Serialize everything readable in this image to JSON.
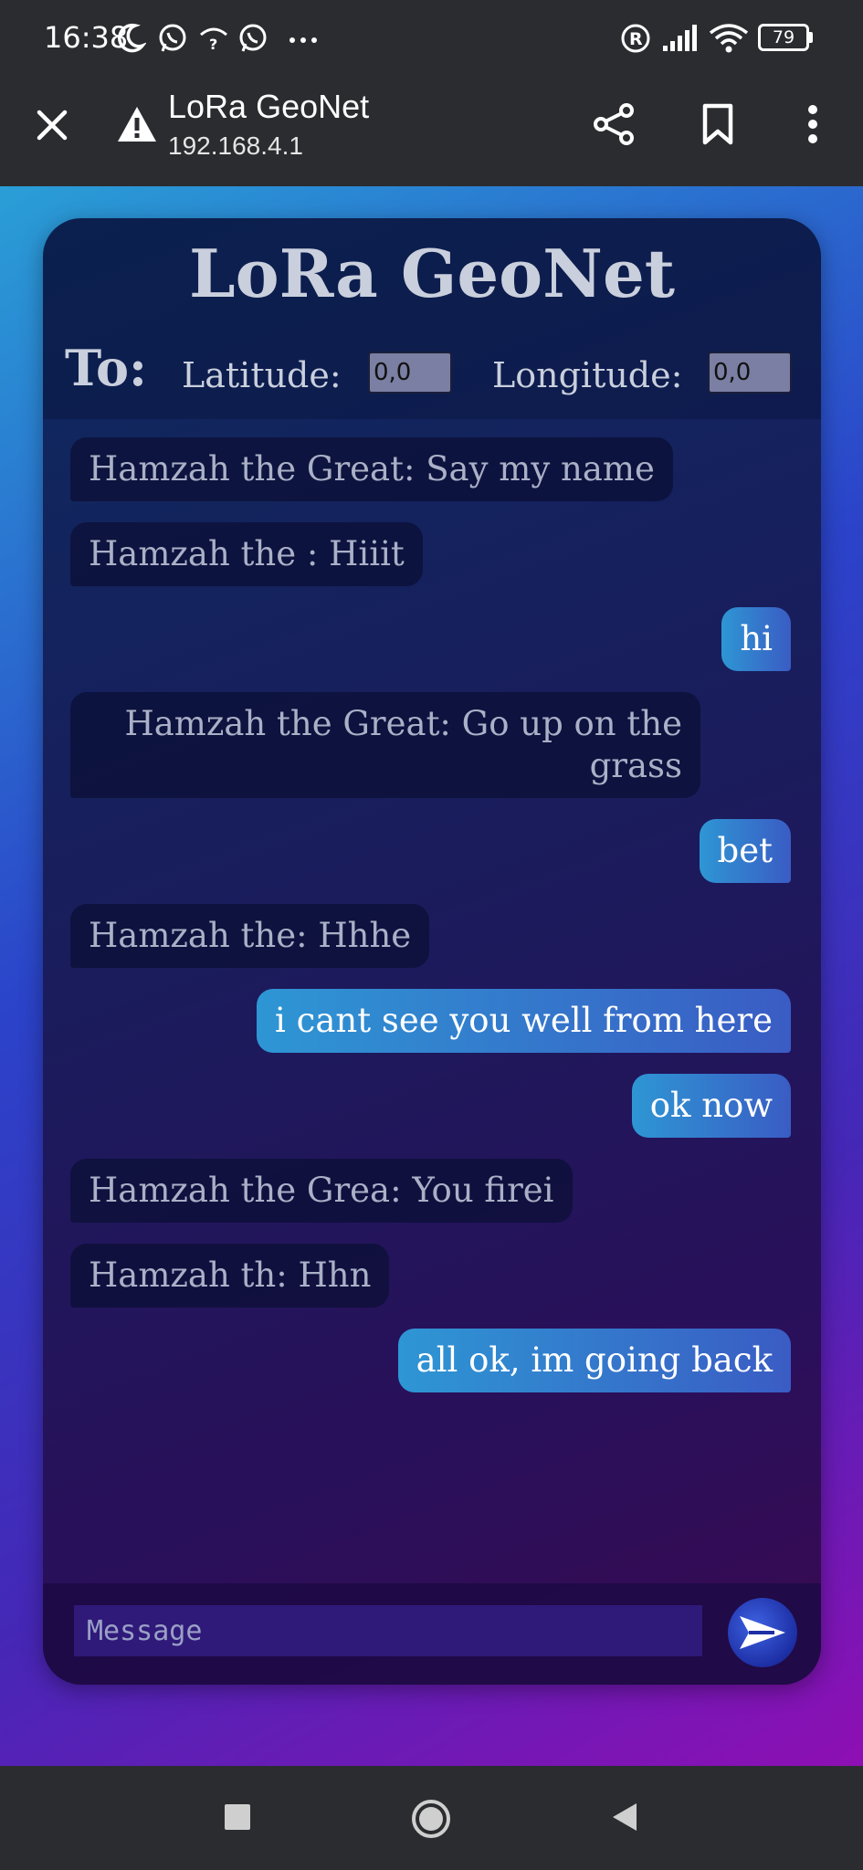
{
  "status_bar": {
    "time": "16:38",
    "icons": [
      "moon-icon",
      "whatsapp-icon",
      "wifi-question-icon",
      "whatsapp-icon",
      "more-dots-icon",
      "registered-icon",
      "signal-icon",
      "wifi-icon",
      "battery-icon"
    ],
    "battery": "79"
  },
  "browser": {
    "close_icon": "close-icon",
    "warning_icon": "warning-icon",
    "title": "LoRa GeoNet",
    "url": "192.168.4.1",
    "actions": [
      "share-icon",
      "bookmark-icon",
      "more-vertical-icon"
    ]
  },
  "app": {
    "title": "LoRa GeoNet",
    "to_label": "To:",
    "latitude_label": "Latitude:",
    "latitude_value": "0,0",
    "longitude_label": "Longitude:",
    "longitude_value": "0,0"
  },
  "messages": [
    {
      "dir": "in",
      "text": "Hamzah the Great: Say my name"
    },
    {
      "dir": "in",
      "text": "Hamzah the : Hiiit"
    },
    {
      "dir": "out",
      "text": "hi"
    },
    {
      "dir": "in",
      "text": "Hamzah the Great: Go up on the grass"
    },
    {
      "dir": "out",
      "text": "bet"
    },
    {
      "dir": "in",
      "text": "Hamzah the: Hhhe"
    },
    {
      "dir": "out",
      "text": "i cant see you well from here"
    },
    {
      "dir": "out",
      "text": "ok now"
    },
    {
      "dir": "in",
      "text": "Hamzah the Grea: You firei"
    },
    {
      "dir": "in",
      "text": "Hamzah th: Hhn"
    },
    {
      "dir": "out",
      "text": "all ok, im going back"
    }
  ],
  "composer": {
    "placeholder": "Message",
    "send_icon": "send-icon"
  },
  "nav_bar": [
    "recents-square-icon",
    "home-circle-icon",
    "back-triangle-icon"
  ],
  "colors": {
    "page_gradient_start": "#2a9ed6",
    "page_gradient_end": "#8e0fb4",
    "outgoing_bubble": "#2e96d4",
    "incoming_bubble": "#0c0f37"
  }
}
